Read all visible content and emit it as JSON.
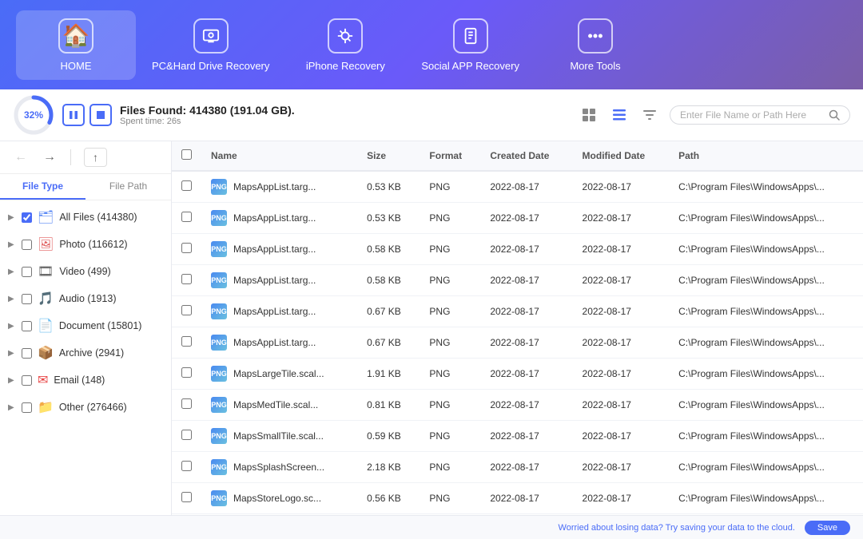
{
  "nav": {
    "items": [
      {
        "id": "home",
        "label": "HOME",
        "icon": "🏠"
      },
      {
        "id": "pc-recovery",
        "label": "PC&Hard Drive Recovery",
        "icon": "🔍"
      },
      {
        "id": "iphone-recovery",
        "label": "iPhone Recovery",
        "icon": "🔄"
      },
      {
        "id": "social-recovery",
        "label": "Social APP Recovery",
        "icon": "📱"
      },
      {
        "id": "more-tools",
        "label": "More Tools",
        "icon": "⋯"
      }
    ]
  },
  "toolbar": {
    "progress": 32,
    "files_found": "Files Found: 414380 (191.04 GB).",
    "spent_time": "Spent time: 26s",
    "search_placeholder": "Enter File Name or Path Here"
  },
  "sidebar": {
    "tab_file_type": "File Type",
    "tab_file_path": "File Path",
    "items": [
      {
        "id": "all",
        "label": "All Files (414380)",
        "icon": "🗂",
        "icon_class": "fi-icon-folder"
      },
      {
        "id": "photo",
        "label": "Photo (116612)",
        "icon": "🖼",
        "icon_class": "fi-icon-photo"
      },
      {
        "id": "video",
        "label": "Video (499)",
        "icon": "🎞",
        "icon_class": "fi-icon-video"
      },
      {
        "id": "audio",
        "label": "Audio (1913)",
        "icon": "🎵",
        "icon_class": "fi-icon-audio"
      },
      {
        "id": "document",
        "label": "Document (15801)",
        "icon": "📄",
        "icon_class": "fi-icon-doc"
      },
      {
        "id": "archive",
        "label": "Archive (2941)",
        "icon": "📦",
        "icon_class": "fi-icon-archive"
      },
      {
        "id": "email",
        "label": "Email (148)",
        "icon": "✉",
        "icon_class": "fi-icon-email"
      },
      {
        "id": "other",
        "label": "Other (276466)",
        "icon": "📁",
        "icon_class": "fi-icon-other"
      }
    ]
  },
  "table": {
    "headers": [
      "",
      "Name",
      "Size",
      "Format",
      "Created Date",
      "Modified Date",
      "Path"
    ],
    "rows": [
      {
        "name": "MapsAppList.targ...",
        "size": "0.53 KB",
        "format": "PNG",
        "created": "2022-08-17",
        "modified": "2022-08-17",
        "path": "C:\\Program Files\\WindowsApps\\..."
      },
      {
        "name": "MapsAppList.targ...",
        "size": "0.53 KB",
        "format": "PNG",
        "created": "2022-08-17",
        "modified": "2022-08-17",
        "path": "C:\\Program Files\\WindowsApps\\..."
      },
      {
        "name": "MapsAppList.targ...",
        "size": "0.58 KB",
        "format": "PNG",
        "created": "2022-08-17",
        "modified": "2022-08-17",
        "path": "C:\\Program Files\\WindowsApps\\..."
      },
      {
        "name": "MapsAppList.targ...",
        "size": "0.58 KB",
        "format": "PNG",
        "created": "2022-08-17",
        "modified": "2022-08-17",
        "path": "C:\\Program Files\\WindowsApps\\..."
      },
      {
        "name": "MapsAppList.targ...",
        "size": "0.67 KB",
        "format": "PNG",
        "created": "2022-08-17",
        "modified": "2022-08-17",
        "path": "C:\\Program Files\\WindowsApps\\..."
      },
      {
        "name": "MapsAppList.targ...",
        "size": "0.67 KB",
        "format": "PNG",
        "created": "2022-08-17",
        "modified": "2022-08-17",
        "path": "C:\\Program Files\\WindowsApps\\..."
      },
      {
        "name": "MapsLargeTile.scal...",
        "size": "1.91 KB",
        "format": "PNG",
        "created": "2022-08-17",
        "modified": "2022-08-17",
        "path": "C:\\Program Files\\WindowsApps\\..."
      },
      {
        "name": "MapsMedTile.scal...",
        "size": "0.81 KB",
        "format": "PNG",
        "created": "2022-08-17",
        "modified": "2022-08-17",
        "path": "C:\\Program Files\\WindowsApps\\..."
      },
      {
        "name": "MapsSmallTile.scal...",
        "size": "0.59 KB",
        "format": "PNG",
        "created": "2022-08-17",
        "modified": "2022-08-17",
        "path": "C:\\Program Files\\WindowsApps\\..."
      },
      {
        "name": "MapsSplashScreen...",
        "size": "2.18 KB",
        "format": "PNG",
        "created": "2022-08-17",
        "modified": "2022-08-17",
        "path": "C:\\Program Files\\WindowsApps\\..."
      },
      {
        "name": "MapsStoreLogo.sc...",
        "size": "0.56 KB",
        "format": "PNG",
        "created": "2022-08-17",
        "modified": "2022-08-17",
        "path": "C:\\Program Files\\WindowsApps\\..."
      }
    ]
  },
  "bottom_bar": {
    "message": "Worried about losing data? Try saving your data to the cloud.",
    "save_btn_label": "Save"
  }
}
